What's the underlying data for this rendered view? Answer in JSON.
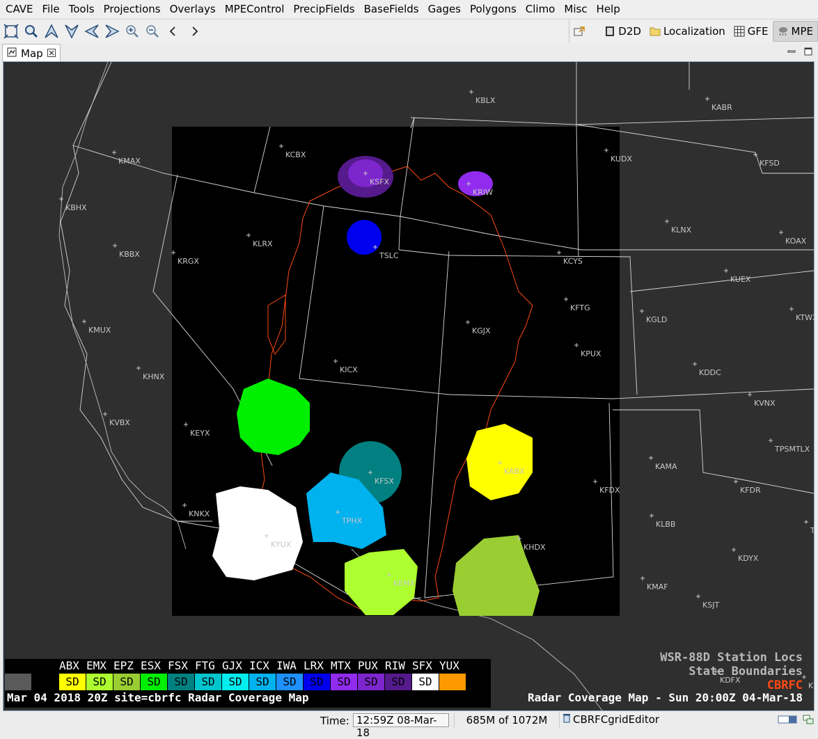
{
  "menu": [
    "CAVE",
    "File",
    "Tools",
    "Projections",
    "Overlays",
    "MPEControl",
    "PrecipFields",
    "BaseFields",
    "Gages",
    "Polygons",
    "Climo",
    "Misc",
    "Help"
  ],
  "toolbar": {
    "tools": [
      "zoom-extent-icon",
      "magnifier-icon",
      "arrow-up-icon",
      "arrow-down-icon",
      "arrow-left-icon",
      "arrow-right-icon",
      "zoom-in-icon",
      "zoom-out-icon",
      "back-icon",
      "forward-icon"
    ]
  },
  "perspectives": {
    "items": [
      "D2D",
      "Localization",
      "GFE",
      "MPE"
    ],
    "active": "MPE"
  },
  "tab": {
    "label": "Map"
  },
  "map": {
    "stations": [
      {
        "id": "KBLX"
      },
      {
        "id": "KABR"
      },
      {
        "id": "KCBX"
      },
      {
        "id": "KUDX"
      },
      {
        "id": "KMAX"
      },
      {
        "id": "KFSD"
      },
      {
        "id": "KSFX"
      },
      {
        "id": "KRIW"
      },
      {
        "id": "KBHX"
      },
      {
        "id": "KLNX"
      },
      {
        "id": "KOAX"
      },
      {
        "id": "KLRX"
      },
      {
        "id": "KBBX"
      },
      {
        "id": "KRGX"
      },
      {
        "id": "TSLC"
      },
      {
        "id": "KCYS"
      },
      {
        "id": "KUEX"
      },
      {
        "id": "KFTG"
      },
      {
        "id": "KGLD"
      },
      {
        "id": "KTWX"
      },
      {
        "id": "KMUX"
      },
      {
        "id": "KGJX"
      },
      {
        "id": "KPUX"
      },
      {
        "id": "KHNX"
      },
      {
        "id": "KICX"
      },
      {
        "id": "KDDC"
      },
      {
        "id": "KVNX"
      },
      {
        "id": "KVBX"
      },
      {
        "id": "KEYX"
      },
      {
        "id": "TPSMTLX"
      },
      {
        "id": "KAMA"
      },
      {
        "id": "KFSX"
      },
      {
        "id": "KABX"
      },
      {
        "id": "KFDX"
      },
      {
        "id": "KFDR"
      },
      {
        "id": "KNKX"
      },
      {
        "id": "TPHX"
      },
      {
        "id": "KLBB"
      },
      {
        "id": "TD"
      },
      {
        "id": "KYUX"
      },
      {
        "id": "KHDX"
      },
      {
        "id": "KDYX"
      },
      {
        "id": "KEMX"
      },
      {
        "id": "KMAF"
      },
      {
        "id": "KSJT"
      },
      {
        "id": "KDFX"
      },
      {
        "id": "KGR"
      }
    ]
  },
  "legend": {
    "codes": [
      "ABX",
      "EMX",
      "EPZ",
      "ESX",
      "FSX",
      "FTG",
      "GJX",
      "ICX",
      "IWA",
      "LRX",
      "MTX",
      "PUX",
      "RIW",
      "SFX",
      "YUX"
    ],
    "swatches": [
      {
        "label": "",
        "color": "#5a5a5a",
        "text": "#000"
      },
      {
        "label": "",
        "color": "#000000",
        "text": "#000"
      },
      {
        "label": "SD",
        "color": "#ffff00",
        "text": "#000"
      },
      {
        "label": "SD",
        "color": "#adff2f",
        "text": "#000"
      },
      {
        "label": "SD",
        "color": "#9acd32",
        "text": "#000"
      },
      {
        "label": "SD",
        "color": "#00ee00",
        "text": "#000"
      },
      {
        "label": "SD",
        "color": "#008080",
        "text": "#000"
      },
      {
        "label": "SD",
        "color": "#00c5cd",
        "text": "#000"
      },
      {
        "label": "SD",
        "color": "#00eeee",
        "text": "#000"
      },
      {
        "label": "SD",
        "color": "#00b2ee",
        "text": "#000"
      },
      {
        "label": "SD",
        "color": "#1e90ff",
        "text": "#000"
      },
      {
        "label": "SD",
        "color": "#0000ee",
        "text": "#000"
      },
      {
        "label": "SD",
        "color": "#912cee",
        "text": "#000"
      },
      {
        "label": "SD",
        "color": "#7d26cd",
        "text": "#000"
      },
      {
        "label": "SD",
        "color": "#551a8b",
        "text": "#000"
      },
      {
        "label": "SD",
        "color": "#ffffff",
        "text": "#000"
      },
      {
        "label": "",
        "color": "#ff9900",
        "text": "#000"
      }
    ],
    "title": "Mar 04 2018 20Z site=cbrfc Radar Coverage Map"
  },
  "overlays": {
    "line1": "WSR-88D Station Locs",
    "line2": "State Boundaries",
    "line3": "CBRFC",
    "maptitle": "Radar Coverage Map - Sun 20:00Z 04-Mar-18"
  },
  "status": {
    "time_label": "Time:",
    "time_value": "12:59Z 08-Mar-18",
    "memory": "685M of 1072M",
    "editor": "CBRFCgridEditor"
  },
  "colors": {
    "cbrfc": "#ff4a12",
    "boundary": "#d8d8d8",
    "background": "#2f2f2f"
  }
}
